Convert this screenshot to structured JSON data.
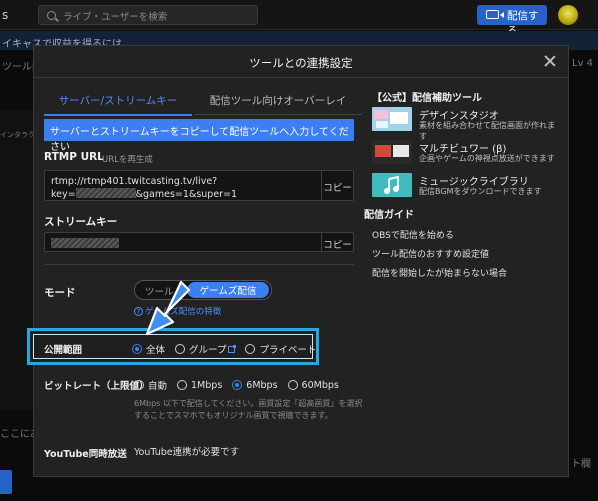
{
  "background": {
    "logo_fragment": "s",
    "search_placeholder": "ライブ・ユーザーを検索",
    "broadcast_button": "配信する",
    "banner_text": "イキャスで収益を得るには",
    "tool_fragment": "ツール配",
    "level_fragment": "Lv 4",
    "side_fragment": "インタラクア",
    "left_fragment": "ここにあ",
    "right_fragment": "ト欄が"
  },
  "modal": {
    "title": "ツールとの連携設定",
    "tabs": [
      {
        "label": "サーバー/ストリームキー",
        "active": true
      },
      {
        "label": "配信ツール向けオーバーレイ",
        "active": false
      }
    ],
    "info_bar": "サーバーとストリームキーをコピーして配信ツールへ入力してください",
    "rtmp": {
      "label": "RTMP URL",
      "sublabel": "URLを再生成",
      "line1": "rtmp://rtmp401.twitcasting.tv/live?",
      "line2_prefix": "key=",
      "line2_suffix": "&games=1&super=1",
      "copy": "コピー"
    },
    "stream_key": {
      "label": "ストリームキー",
      "copy": "コピー"
    },
    "mode": {
      "label": "モード",
      "options": [
        "ツール",
        "ゲームズ配信"
      ],
      "selected": "ゲームズ配信",
      "link": "ゲームズ配信の特徴"
    },
    "visibility": {
      "label": "公開範囲",
      "options": [
        "全体",
        "グループ",
        "プライベート"
      ],
      "selected": "全体"
    },
    "bitrate": {
      "label": "ビットレート（上限値）",
      "options": [
        "自動",
        "1Mbps",
        "6Mbps",
        "60Mbps"
      ],
      "selected": "6Mbps",
      "note": "6Mbps 以下で配信してください。画質設定「超高画質」を選択することでスマホでもオリジナル画質で視聴できます。"
    },
    "youtube": {
      "label": "YouTube同時放送",
      "value": "YouTube連携が必要です"
    },
    "official_tools": {
      "title": "【公式】配信補助ツール",
      "items": [
        {
          "name": "デザインスタジオ",
          "desc": "素材を組み合わせて配信画面が作れます"
        },
        {
          "name": "マルチビュワー (β)",
          "desc": "企画やゲームの神視点放送ができます"
        },
        {
          "name": "ミュージックライブラリ",
          "desc": "配信BGMをダウンロードできます"
        }
      ]
    },
    "guide": {
      "title": "配信ガイド",
      "links": [
        "OBSで配信を始める",
        "ツール配信のおすすめ設定値",
        "配信を開始したが始まらない場合"
      ]
    }
  },
  "colors": {
    "accent_blue": "#3d7ff2",
    "highlight_cyan": "#24a9e1",
    "modal_bg": "#222222"
  }
}
